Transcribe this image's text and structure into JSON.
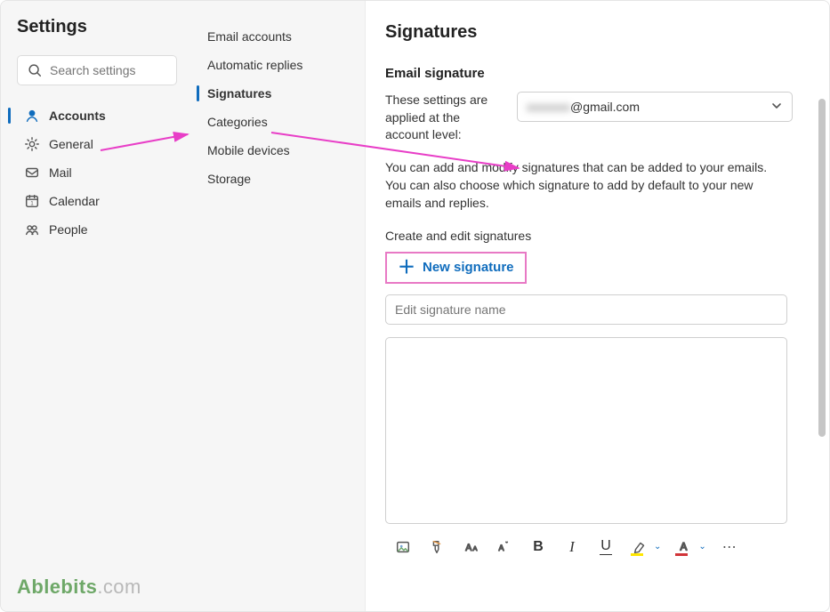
{
  "searchPlaceholder": "Search settings",
  "sidebarTitle": "Settings",
  "nav": [
    {
      "label": "Accounts"
    },
    {
      "label": "General"
    },
    {
      "label": "Mail"
    },
    {
      "label": "Calendar"
    },
    {
      "label": "People"
    }
  ],
  "mid": [
    {
      "label": "Email accounts"
    },
    {
      "label": "Automatic replies"
    },
    {
      "label": "Signatures"
    },
    {
      "label": "Categories"
    },
    {
      "label": "Mobile devices"
    },
    {
      "label": "Storage"
    }
  ],
  "pane": {
    "title": "Signatures",
    "section": "Email signature",
    "applyLabel": "These settings are applied at the account level:",
    "accountMasked": "xxxxxxx",
    "accountSuffix": "@gmail.com",
    "help": "You can add and modify signatures that can be added to your emails. You can also choose which signature to add by default to your new emails and replies.",
    "createEdit": "Create and edit signatures",
    "newSignature": "New signature",
    "editNamePlaceholder": "Edit signature name"
  },
  "watermark": {
    "a": "Ablebits",
    "b": ".com"
  }
}
